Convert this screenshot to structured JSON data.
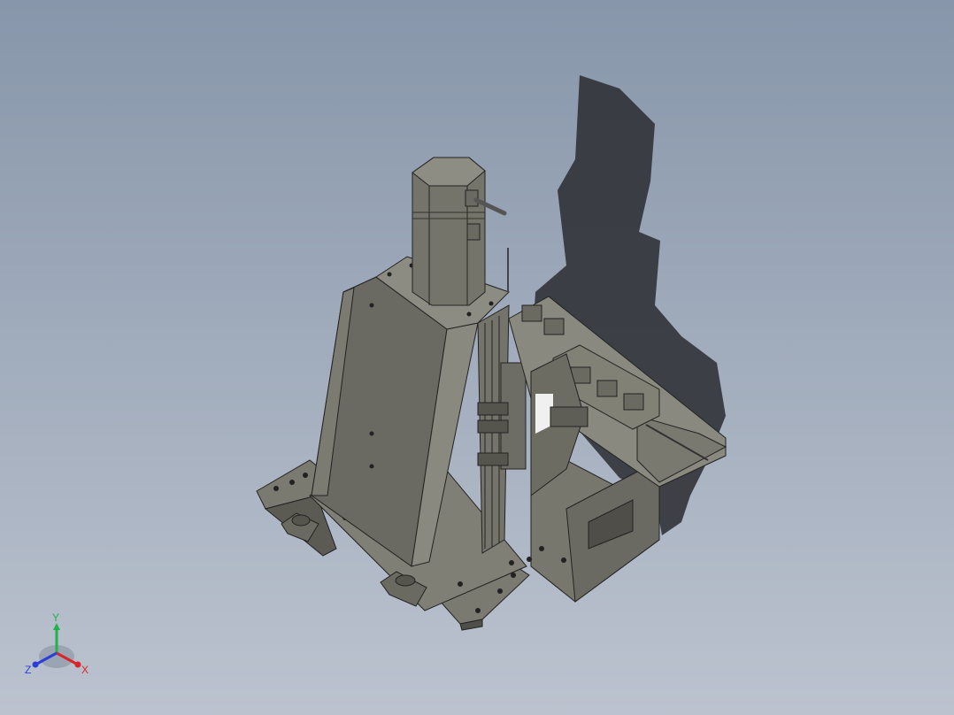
{
  "viewport": {
    "background_top": "#8796aa",
    "background_bottom": "#bcc3cf",
    "model_color": "#6f6f66",
    "shadow_color": "#2a2c30"
  },
  "triad": {
    "x_label": "X",
    "y_label": "Y",
    "z_label": "Z",
    "x_color": "#d8262a",
    "y_color": "#22b24c",
    "z_color": "#2a3fd8"
  }
}
